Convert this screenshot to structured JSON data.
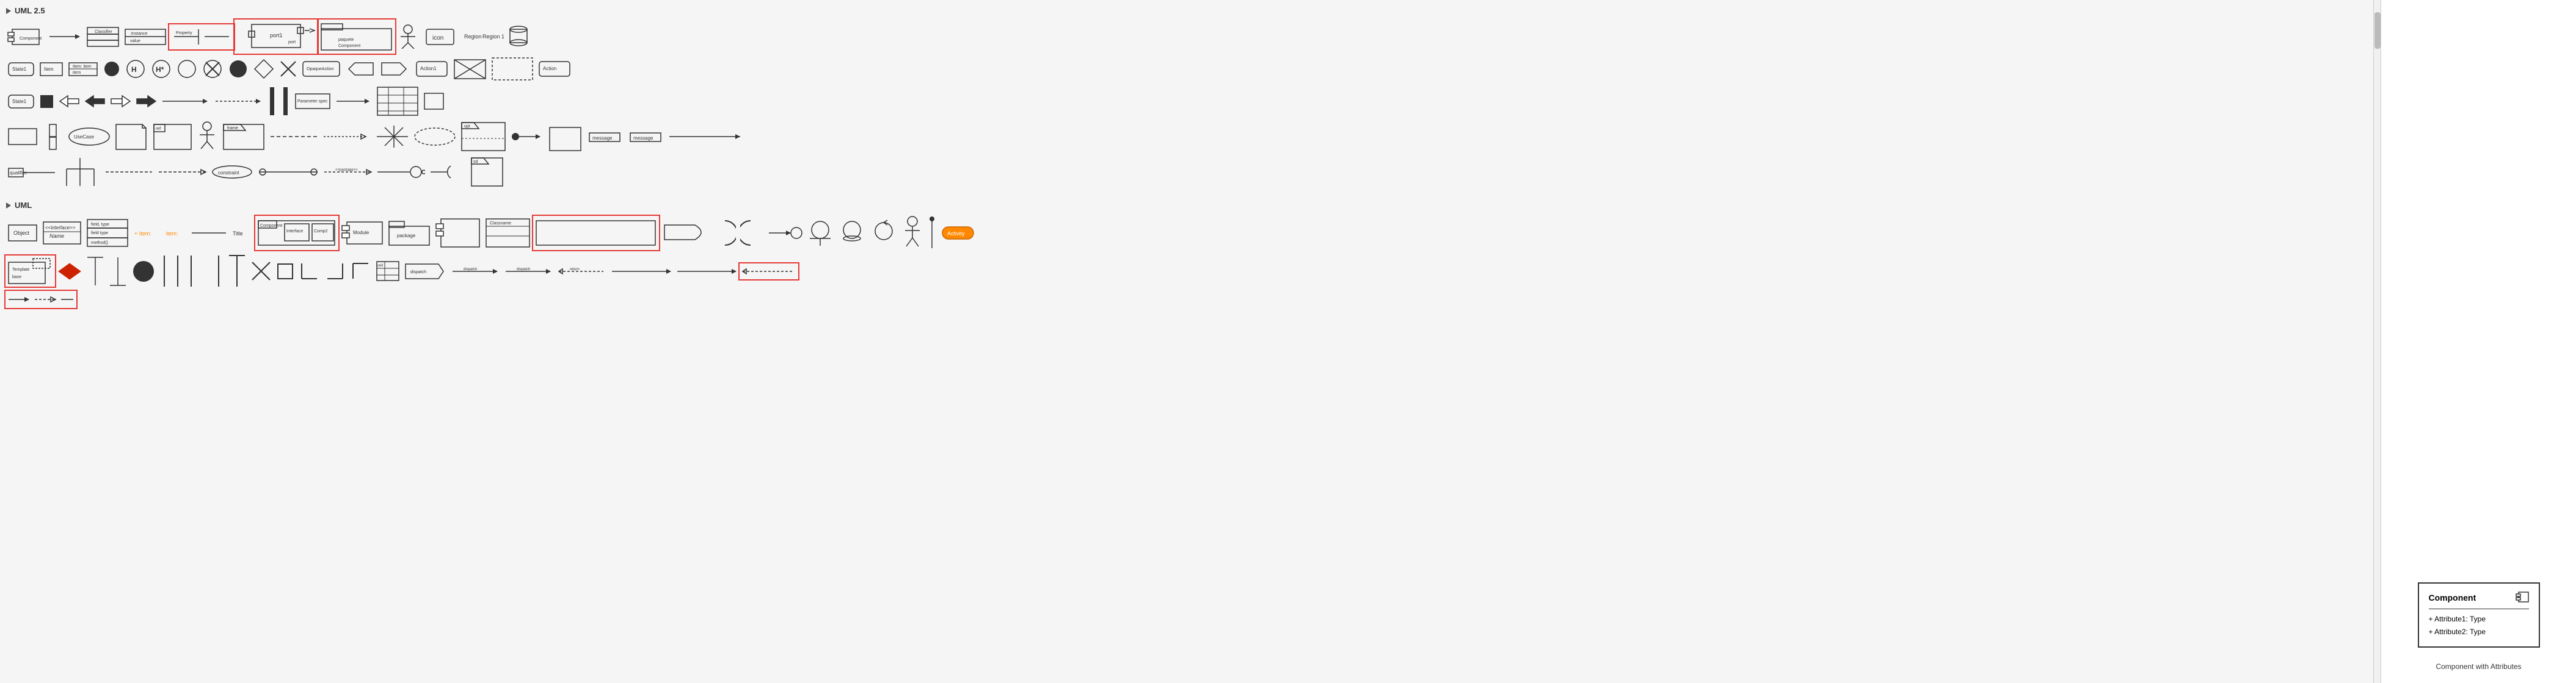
{
  "sections": [
    {
      "id": "uml25",
      "title": "UML 2.5",
      "expanded": true
    },
    {
      "id": "uml",
      "title": "UML",
      "expanded": true
    }
  ],
  "rightPanel": {
    "componentTitle": "Component",
    "attribute1": "+ Attribute1: Type",
    "attribute2": "+ Attribute2: Type",
    "label": "Component with Attributes"
  },
  "scrollbar": {
    "visible": true
  }
}
